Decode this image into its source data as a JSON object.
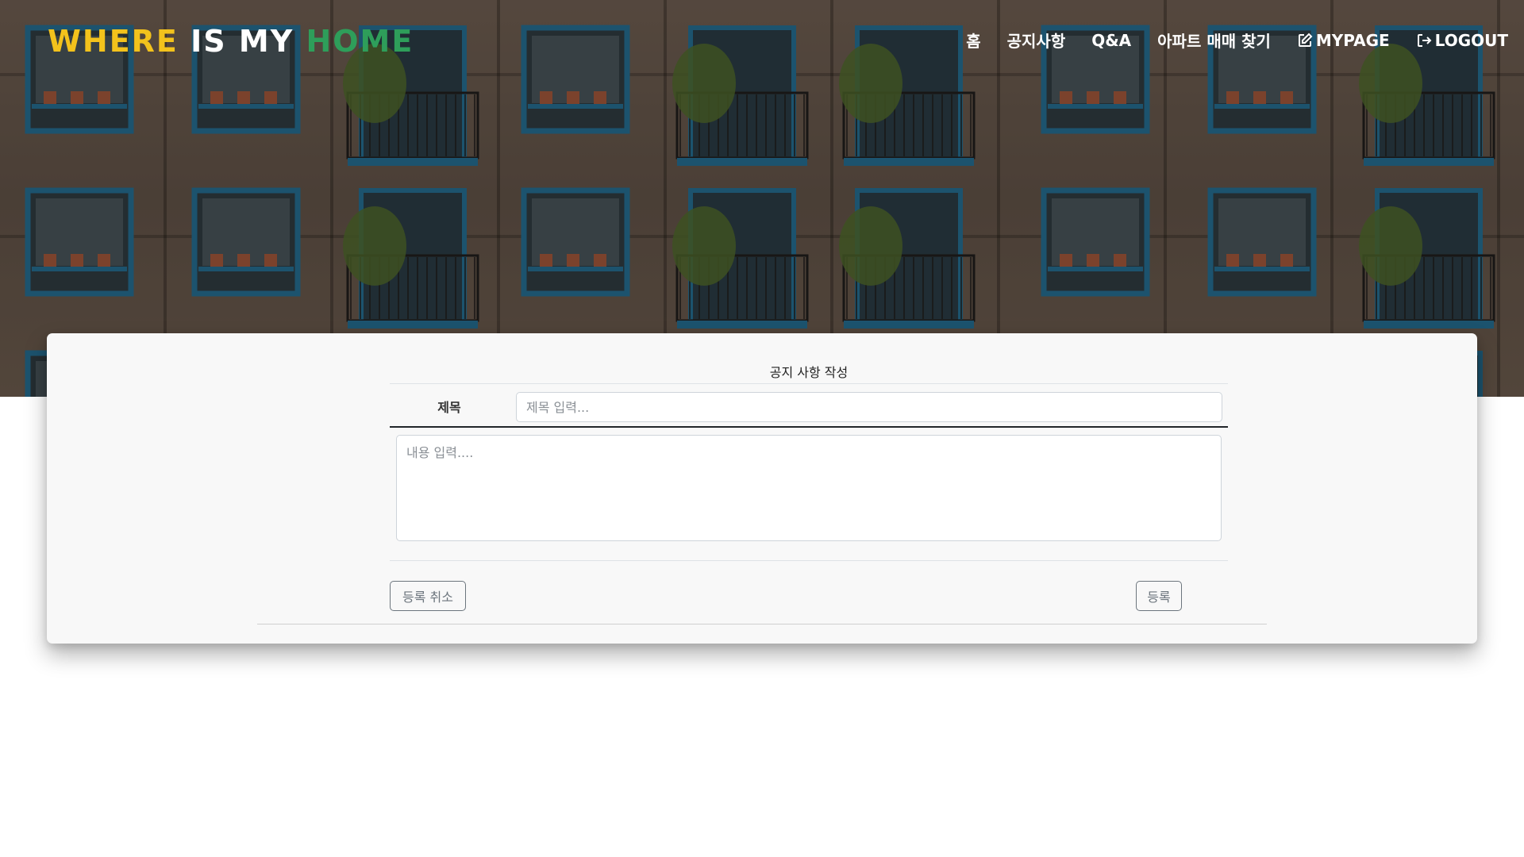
{
  "brand": {
    "word1": "WHERE",
    "word2": "IS MY",
    "word3": "HOME"
  },
  "nav": {
    "home": "홈",
    "notice": "공지사항",
    "qna": "Q&A",
    "apartment": "아파트 매매 찾기",
    "mypage": "MYPAGE",
    "logout": "LOGOUT"
  },
  "form": {
    "heading": "공지 사항 작성",
    "title_label": "제목",
    "title_placeholder": "제목 입력...",
    "content_placeholder": "내용 입력....",
    "cancel_label": "등록 취소",
    "submit_label": "등록"
  },
  "icons": {
    "mypage": "edit-icon",
    "logout": "sign-out-icon"
  },
  "colors": {
    "brand_yellow": "#f3c21c",
    "brand_white": "#ffffff",
    "brand_green": "#2e9e5a",
    "window_frame": "#1f6e95"
  }
}
